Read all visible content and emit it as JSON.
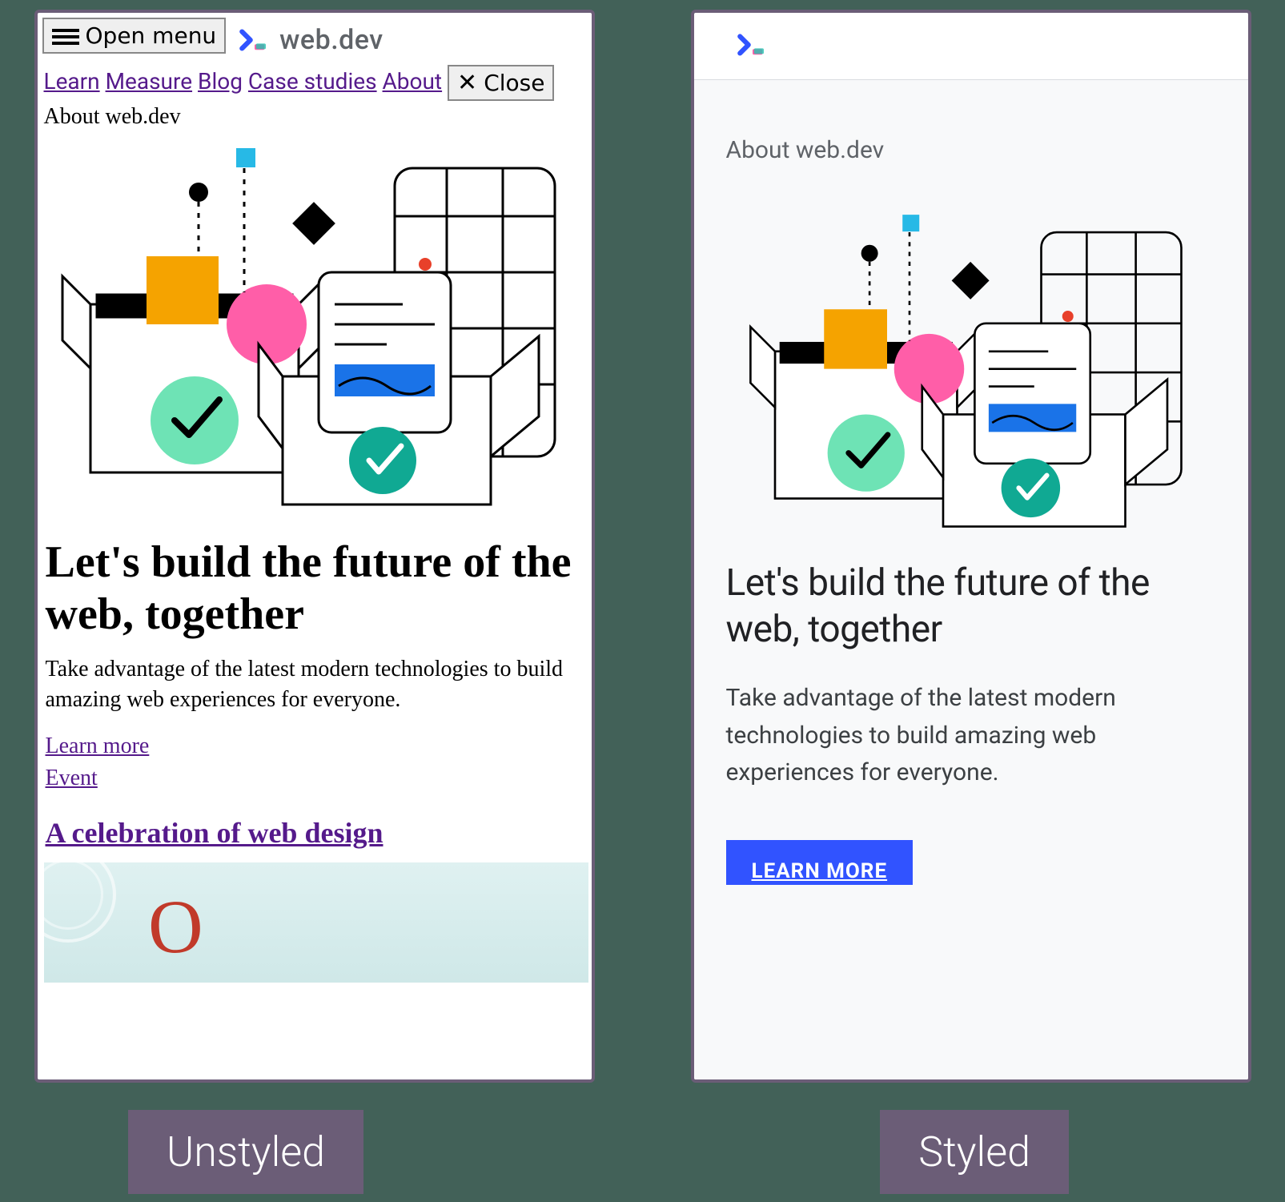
{
  "captions": {
    "unstyled": "Unstyled",
    "styled": "Styled"
  },
  "unstyled": {
    "open_menu_label": "Open menu",
    "wordmark": "web.dev",
    "nav": {
      "learn": "Learn",
      "measure": "Measure",
      "blog": "Blog",
      "case_studies": "Case studies",
      "about": "About"
    },
    "close_label": "Close",
    "eyebrow": "About web.dev",
    "h1": "Let's build the future of the web, together",
    "lead": "Take advantage of the latest modern technologies to build amazing web experiences for everyone.",
    "learn_more": "Learn more",
    "event": "Event",
    "h2_link": "A celebration of web design"
  },
  "styled": {
    "eyebrow": "About web.dev",
    "h1": "Let's build the future of the web, together",
    "lead": "Take advantage of the latest modern technologies to build amazing web experiences for everyone.",
    "cta": "LEARN MORE"
  }
}
